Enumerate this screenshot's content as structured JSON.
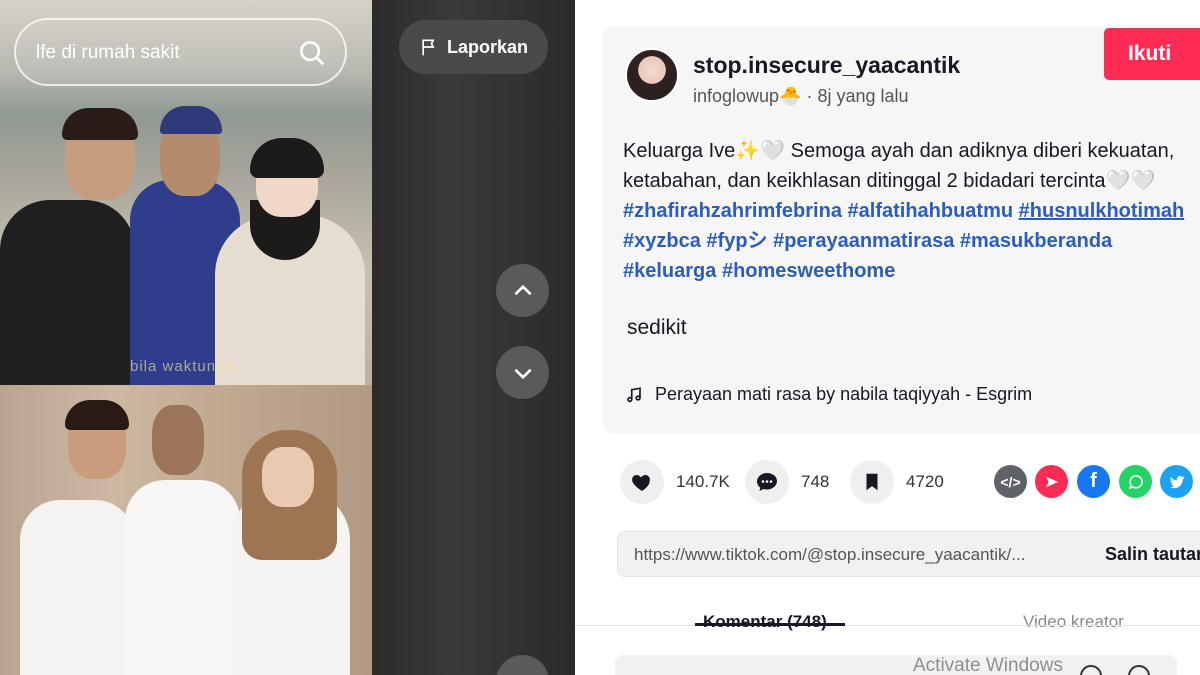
{
  "video": {
    "search_text": "lfe di rumah sakit",
    "report_label": "Laporkan",
    "watermark": "bila waktunya"
  },
  "post": {
    "username": "stop.insecure_yaacantik",
    "author": "infoglowup",
    "author_emoji": "🐣",
    "time": "8j yang lalu",
    "follow_label": "Ikuti",
    "caption_text": "Keluarga Ive✨🤍 Semoga ayah dan adiknya diberi kekuatan,",
    "caption_text2": "ketabahan, dan keikhlasan ditinggal 2 bidadari tercinta🤍🤍",
    "hashtags": [
      "#zhafirahzahrimfebrina",
      "#alfatihahbuatmu",
      "#husnulkhotimah",
      "#xyzbca",
      "#fypシ",
      "#perayaanmatirasa",
      "#masukberanda",
      "#keluarga",
      "#homesweethome"
    ],
    "extra_text": "sedikit",
    "music": "Perayaan mati rasa by nabila taqiyyah - Esgrim"
  },
  "stats": {
    "likes": "140.7K",
    "comments": "748",
    "saves": "4720"
  },
  "share_icons": [
    "embed-icon",
    "send-icon",
    "facebook-icon",
    "whatsapp-icon",
    "twitter-icon"
  ],
  "link": {
    "url": "https://www.tiktok.com/@stop.insecure_yaacantik/...",
    "copy_label": "Salin tautan"
  },
  "tabs": [
    {
      "label": "Komentar (748)"
    },
    {
      "label": "Video kreator"
    }
  ],
  "overlay": {
    "activate_windows": "Activate Windows"
  },
  "colors": {
    "accent": "#fe2c55",
    "hashtag": "#2b5db9"
  }
}
